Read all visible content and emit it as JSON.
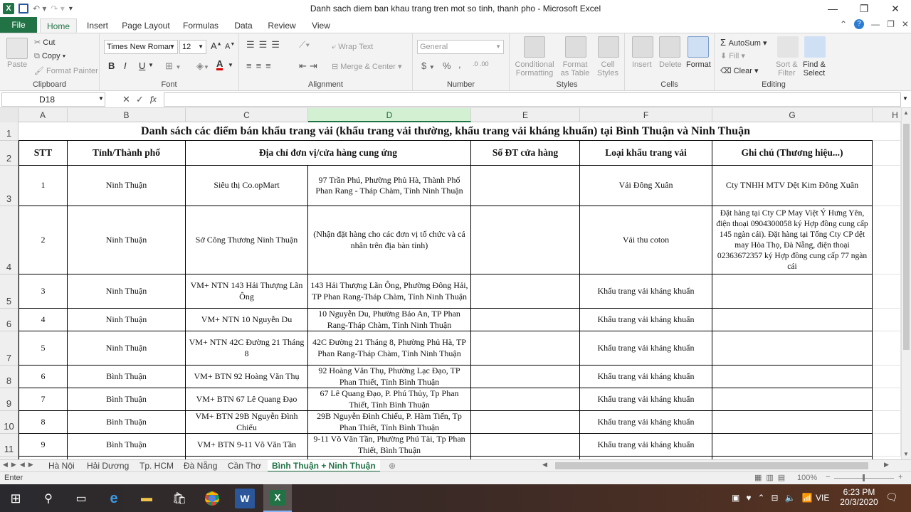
{
  "window": {
    "title": "Danh sach diem ban khau trang tren mot so tinh, thanh pho  -  Microsoft Excel",
    "minimize": "—",
    "restore": "❐",
    "close": "✕"
  },
  "ribbon_tabs": [
    "File",
    "Home",
    "Insert",
    "Page Layout",
    "Formulas",
    "Data",
    "Review",
    "View"
  ],
  "ribbon": {
    "clipboard": {
      "paste": "Paste",
      "cut": "Cut",
      "copy": "Copy",
      "format_painter": "Format Painter",
      "label": "Clipboard"
    },
    "font": {
      "name": "Times New Roman",
      "size": "12",
      "bold": "B",
      "italic": "I",
      "underline": "U",
      "label": "Font"
    },
    "alignment": {
      "wrap_text": "Wrap Text",
      "merge_center": "Merge & Center",
      "label": "Alignment"
    },
    "number": {
      "format": "General",
      "currency": "$",
      "percent": "%",
      "comma": ",",
      "label": "Number"
    },
    "styles": {
      "conditional": "Conditional",
      "conditional2": "Formatting",
      "format_as": "Format",
      "format_as2": "as Table",
      "cell": "Cell",
      "cell2": "Styles",
      "label": "Styles"
    },
    "cells": {
      "insert": "Insert",
      "delete": "Delete",
      "format": "Format",
      "label": "Cells"
    },
    "editing": {
      "autosum": "AutoSum",
      "fill": "Fill",
      "clear": "Clear",
      "sort": "Sort &",
      "sort2": "Filter",
      "find": "Find &",
      "find2": "Select",
      "label": "Editing"
    }
  },
  "formula_bar": {
    "name_box": "D18",
    "fx": "fx",
    "value": ""
  },
  "columns": [
    "A",
    "B",
    "C",
    "D",
    "E",
    "F",
    "G",
    "H"
  ],
  "rows": [
    "1",
    "2",
    "3",
    "4",
    "5",
    "6",
    "7",
    "8",
    "9",
    "10",
    "11"
  ],
  "sheet": {
    "title": "Danh sách các điểm bán khẩu trang vải (khẩu trang vải thường, khẩu trang vải kháng khuẩn) tại Bình Thuận và Ninh Thuận",
    "headers": [
      "STT",
      "Tỉnh/Thành phố",
      "Địa chỉ đơn vị/cửa hàng cung ứng",
      "",
      "Số ĐT cửa hàng",
      "Loại khẩu trang vải",
      "Ghi chú (Thương hiệu...)"
    ],
    "data_rows": [
      [
        "1",
        "Ninh Thuận",
        "Siêu thị Co.opMart",
        "97 Trần Phú, Phường Phủ Hà, Thành Phố Phan Rang - Tháp Chàm, Tỉnh Ninh Thuận",
        "",
        "Vải Đông Xuân",
        "Cty TNHH MTV Dệt Kim Đông Xuân"
      ],
      [
        "2",
        "Ninh Thuận",
        "Sở Công Thương Ninh Thuận",
        "(Nhận đặt hàng cho các đơn vị tổ chức và cá nhân trên địa bàn tỉnh)",
        "",
        "Vải thu coton",
        "Đặt hàng tại Cty CP May Việt Ý Hưng Yên, điện thoại 0904300058 ký Hợp đồng cung cấp 145 ngàn cái). Đặt hàng tại Tổng Cty CP dệt may Hòa Thọ, Đà Nẵng, điện thoại 02363672357 ký Hợp đồng cung cấp 77 ngàn cái"
      ],
      [
        "3",
        "Ninh Thuận",
        "VM+ NTN 143 Hải Thượng Lãn Ông",
        "143 Hải Thượng Lãn Ông, Phường Đông Hải, TP Phan Rang-Tháp Chàm, Tỉnh Ninh Thuận",
        "",
        "Khẩu trang vải kháng khuẩn",
        ""
      ],
      [
        "4",
        "Ninh Thuận",
        "VM+ NTN 10 Nguyễn Du",
        "10 Nguyễn Du, Phường Bảo An, TP Phan Rang-Tháp Chàm, Tỉnh Ninh Thuận",
        "",
        "Khẩu trang vải kháng khuẩn",
        ""
      ],
      [
        "5",
        "Ninh Thuận",
        "VM+ NTN 42C Đường 21 Tháng 8",
        "42C Đường 21 Tháng 8, Phường Phủ Hà, TP Phan Rang-Tháp Chàm, Tỉnh Ninh Thuận",
        "",
        "Khẩu trang vải kháng khuẩn",
        ""
      ],
      [
        "6",
        "Bình Thuận",
        "VM+ BTN 92 Hoàng Văn Thụ",
        "92 Hoàng Văn Thụ, Phường Lạc Đạo, TP Phan Thiết, Tỉnh Bình Thuận",
        "",
        "Khẩu trang vải kháng khuẩn",
        ""
      ],
      [
        "7",
        "Bình Thuận",
        "VM+ BTN 67 Lê Quang Đạo",
        "67 Lê Quang Đạo, P. Phú Thủy, Tp Phan Thiết, Tỉnh Bình Thuận",
        "",
        "Khẩu trang vải kháng khuẩn",
        ""
      ],
      [
        "8",
        "Bình Thuận",
        "VM+ BTN 29B Nguyễn Đình Chiểu",
        "29B Nguyễn Đình Chiểu, P. Hàm Tiến, Tp Phan Thiết, Tỉnh Bình Thuận",
        "",
        "Khẩu trang vải kháng khuẩn",
        ""
      ],
      [
        "9",
        "Bình Thuận",
        "VM+ BTN 9-11 Võ Văn Tần",
        "9-11 Võ Văn Tần, Phường Phú Tài, Tp Phan Thiết, Bình Thuận",
        "",
        "Khẩu trang vải kháng khuẩn",
        ""
      ]
    ]
  },
  "sheet_tabs": [
    "Hà Nội",
    "Hải Dương",
    "Tp. HCM",
    "Đà Nẵng",
    "Cần Thơ",
    "Bình Thuận + Ninh Thuận"
  ],
  "active_sheet": "Bình Thuận + Ninh Thuận",
  "status": {
    "mode": "Enter",
    "zoom": "100%"
  },
  "taskbar": {
    "lang": "VIE",
    "time": "6:23 PM",
    "date": "20/3/2020"
  },
  "colors": {
    "excel_green": "#217346",
    "ribbon_bg": "#f3f3f3"
  }
}
